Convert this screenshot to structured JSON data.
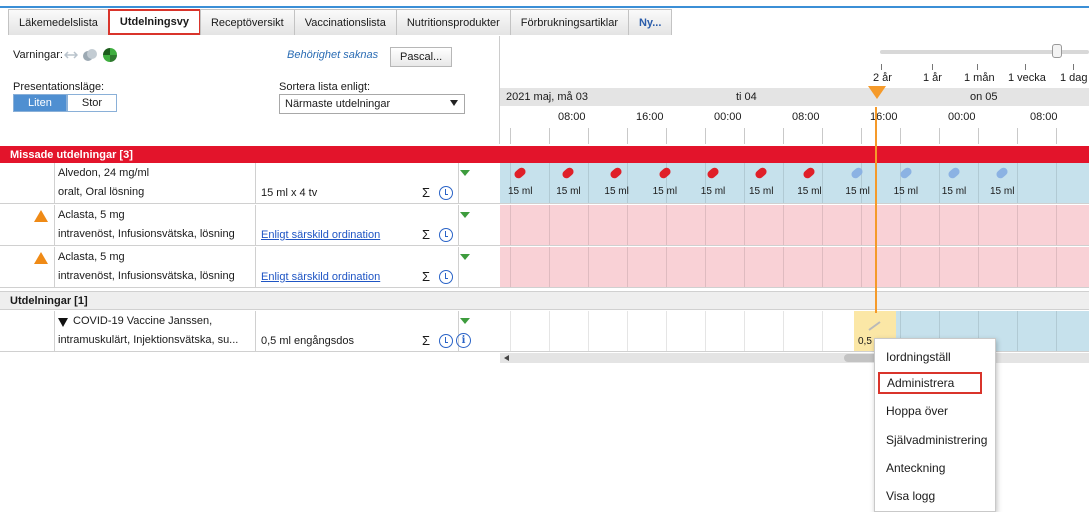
{
  "tabs": [
    {
      "label": "Läkemedelslista",
      "active": false
    },
    {
      "label": "Utdelningsvy",
      "active": true
    },
    {
      "label": "Receptöversikt",
      "active": false
    },
    {
      "label": "Vaccinationslista",
      "active": false
    },
    {
      "label": "Nutritionsprodukter",
      "active": false
    },
    {
      "label": "Förbrukningsartiklar",
      "active": false
    },
    {
      "label": "Ny...",
      "active": false
    }
  ],
  "left_panel": {
    "warnings_label": "Varningar:",
    "presentation_label": "Presentationsläge:",
    "mode_small": "Liten",
    "mode_large": "Stor",
    "permission_text": "Behörighet saknas",
    "user_button": "Pascal...",
    "sort_label": "Sortera lista enligt:",
    "sort_value": "Närmaste utdelningar"
  },
  "timeline": {
    "zoom_labels": [
      "2 år",
      "1 år",
      "1 mån",
      "1 vecka",
      "1 dag"
    ],
    "dates": [
      "2021 maj, må 03",
      "ti 04",
      "on 05"
    ],
    "times": [
      "08:00",
      "16:00",
      "00:00",
      "08:00",
      "16:00",
      "00:00",
      "08:00"
    ]
  },
  "sections": {
    "missed": "Missade utdelningar [3]",
    "admin": "Utdelningar [1]"
  },
  "rows": [
    {
      "name1": "Alvedon, 24 mg/ml",
      "name2": "oralt, Oral lösning",
      "dose": "15 ml x 4 tv",
      "link": false
    },
    {
      "name1": "Aclasta, 5 mg",
      "name2": "intravenöst, Infusionsvätska, lösning",
      "dose": "Enligt särskild ordination",
      "link": true
    },
    {
      "name1": "Aclasta, 5 mg",
      "name2": "intravenöst, Infusionsvätska, lösning",
      "dose": "Enligt särskild ordination",
      "link": true
    },
    {
      "name1": "COVID-19 Vaccine Janssen,",
      "name2": "intramuskulärt, Injektionsvätska, su...",
      "dose": "0,5 ml engångsdos",
      "link": false
    }
  ],
  "sigma_symbol": "Σ",
  "info_symbol": "i",
  "dose_marks": {
    "label": "15 ml",
    "missed_count": 7,
    "upcoming_count": 4,
    "covid_label": "0,5"
  },
  "context_menu": {
    "items": [
      "Iordningställ",
      "Administrera",
      "Hoppa över",
      "Självadministrering",
      "Anteckning",
      "Visa logg"
    ],
    "highlighted": "Administrera"
  },
  "colors": {
    "missed_header": "#e3142b",
    "accent_blue": "#4f8fd1",
    "now_marker": "#f59a2a",
    "highlight_border": "#d9342b"
  }
}
